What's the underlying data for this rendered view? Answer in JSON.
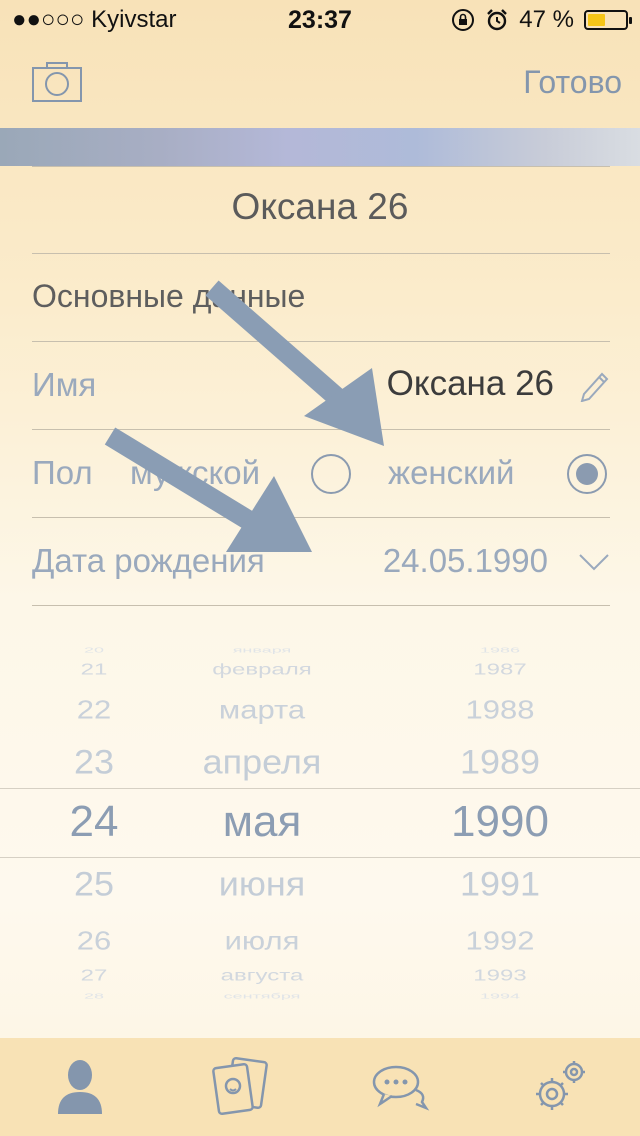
{
  "status_bar": {
    "carrier": "●●○○○ Kyivstar",
    "time": "23:37",
    "battery_percent": "47 %",
    "battery_level": 0.47
  },
  "nav": {
    "done_label": "Готово"
  },
  "profile": {
    "title": "Оксана 26",
    "section_title": "Основные данные",
    "name_label": "Имя",
    "name_value": "Оксана 26",
    "gender_label": "Пол",
    "gender_male": "мужской",
    "gender_female": "женский",
    "gender_selected": "female",
    "birthdate_label": "Дата рождения",
    "birthdate_value": "24.05.1990"
  },
  "picker": {
    "days": [
      "20",
      "21",
      "22",
      "23",
      "24",
      "25",
      "26",
      "27",
      "28"
    ],
    "months": [
      "января",
      "февраля",
      "марта",
      "апреля",
      "мая",
      "июня",
      "июля",
      "августа",
      "сентября"
    ],
    "years": [
      "1986",
      "1987",
      "1988",
      "1989",
      "1990",
      "1991",
      "1992",
      "1993",
      "1994"
    ],
    "selected_index": 4
  },
  "colors": {
    "accent": "#8496ad",
    "annotation_arrow": "#8a9db4"
  }
}
